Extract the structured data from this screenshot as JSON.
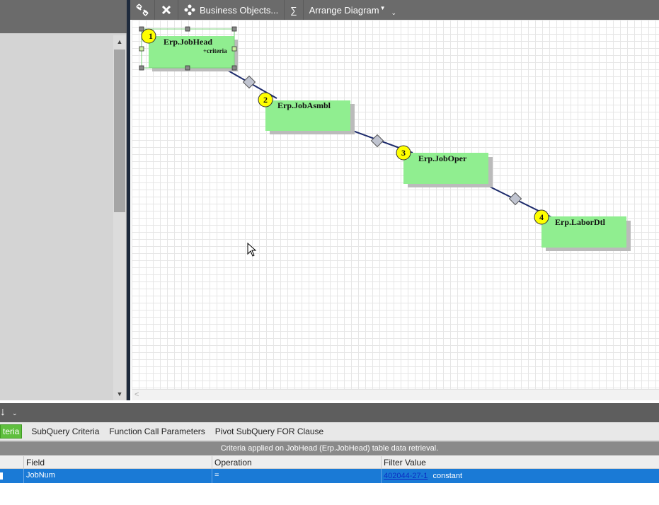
{
  "toolbar": {
    "business_objects_label": "Business Objects...",
    "sum_label": "∑",
    "arrange_label": "Arrange Diagram"
  },
  "diagram": {
    "nodes": [
      {
        "num": "1",
        "title": "Erp.JobHead",
        "sub": "+criteria"
      },
      {
        "num": "2",
        "title": "Erp.JobAsmbl",
        "sub": ""
      },
      {
        "num": "3",
        "title": "Erp.JobOper",
        "sub": ""
      },
      {
        "num": "4",
        "title": "Erp.LaborDtl",
        "sub": ""
      }
    ]
  },
  "bottom": {
    "tabs": [
      "teria",
      "SubQuery Criteria",
      "Function Call Parameters",
      "Pivot SubQuery FOR Clause"
    ],
    "info": "Criteria applied on JobHead (Erp.JobHead)  table data retrieval.",
    "columns": [
      "Field",
      "Operation",
      "Filter Value"
    ],
    "row": {
      "field": "JobNum",
      "operation": "=",
      "filter_link": "402044-27-1",
      "filter_type": "constant"
    }
  },
  "colors": {
    "node_fill": "#90ee90",
    "badge_fill": "#ffff00",
    "link_color": "#1c2a6b",
    "active_tab": "#5fbf3e",
    "selected_row": "#1a7ad6"
  }
}
